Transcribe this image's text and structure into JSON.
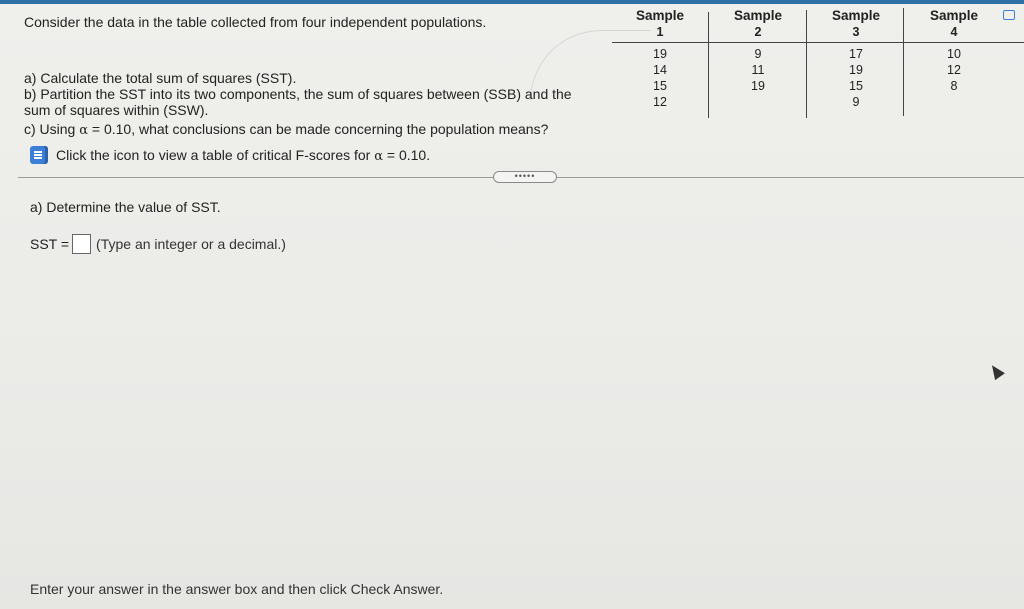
{
  "question": {
    "intro": "Consider the data in the table collected from four independent populations.",
    "part_a": "a) Calculate the total sum of squares (SST).",
    "part_b": "b) Partition the SST into its two components, the sum of squares between (SSB) and the sum of squares within (SSW).",
    "part_c_prefix": "c) Using ",
    "alpha_symbol": "α",
    "part_c_value": " = 0.10, what conclusions can be made concerning the population means?",
    "icon_prefix": "Click the icon to view a table of critical F-scores for ",
    "icon_value": " = 0.10."
  },
  "table": {
    "columns": [
      {
        "header": "Sample",
        "number": "1",
        "values": [
          "19",
          "14",
          "15",
          "12"
        ]
      },
      {
        "header": "Sample",
        "number": "2",
        "values": [
          "9",
          "11",
          "19"
        ]
      },
      {
        "header": "Sample",
        "number": "3",
        "values": [
          "17",
          "19",
          "15",
          "9"
        ]
      },
      {
        "header": "Sample",
        "number": "4",
        "values": [
          "10",
          "12",
          "8"
        ]
      }
    ]
  },
  "divider": {
    "more_label": "•••••"
  },
  "answer": {
    "prompt": "a) Determine the value of SST.",
    "label": "SST =",
    "value": "",
    "hint": "(Type an integer or a decimal.)"
  },
  "footer": {
    "instruction": "Enter your answer in the answer box and then click Check Answer."
  },
  "colors": {
    "accent": "#2f6fa6",
    "icon": "#3b7fd8"
  }
}
